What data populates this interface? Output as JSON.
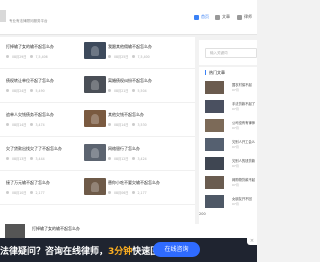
{
  "header": {
    "tagline": "专业有法律顾问服务平台",
    "nav": [
      {
        "label": "首页",
        "icon": "home-icon"
      },
      {
        "label": "文章",
        "icon": "article-icon"
      },
      {
        "label": "律师",
        "icon": "lawyer-icon"
      }
    ]
  },
  "articles": [
    {
      "title": "打掉输了女的输不起怎么办",
      "date": "08月29日",
      "views": "7,5,406"
    },
    {
      "title": "我跟其他佣输不起怎么办",
      "date": "08月25日",
      "views": "7,5,400"
    },
    {
      "title": "债权转让单位不起了怎么办",
      "date": "08月24日",
      "views": "5,490"
    },
    {
      "title": "离婚债权纠纷不起怎么办",
      "date": "08月21日",
      "views": "5,504"
    },
    {
      "title": "追单人欠钱债务不起怎么办",
      "date": "08月14日",
      "views": "3,474"
    },
    {
      "title": "其他欠钱不起怎么办",
      "date": "08月14日",
      "views": "3,530"
    },
    {
      "title": "欠了贷款出找欠了了不起怎么办",
      "date": "08月13日",
      "views": "3,444"
    },
    {
      "title": "网络银行了怎么办",
      "date": "08月12日",
      "views": "3,424"
    },
    {
      "title": "接了万元输不起了怎么办",
      "date": "08月10日",
      "views": "2,177"
    },
    {
      "title": "替你小吃不要欠输不起怎么办",
      "date": "08月06日",
      "views": "2,177"
    }
  ],
  "sidebar": {
    "search_placeholder": "输入关键词",
    "hot_title": "热门文章",
    "hot_items": [
      {
        "text": "国农村保不起",
        "date": "07月"
      },
      {
        "text": "手法贷款不起了",
        "date": "07月"
      },
      {
        "text": "公司没有有律师",
        "date": "07月"
      },
      {
        "text": "欠别人开工会么",
        "date": "07月"
      },
      {
        "text": "欠别人的钱贷款",
        "date": "07月"
      },
      {
        "text": "网购物贷款不起",
        "date": "07月"
      },
      {
        "text": "女朋友开不回",
        "date": "07月"
      }
    ]
  },
  "footer_strip": {
    "title": "打掉输了女的输不起怎么办",
    "side": "200"
  },
  "banner": {
    "text_before": "法律疑问？咨询在线律师，",
    "highlight": "3分钟",
    "text_after": "快速回复！",
    "button": "在线咨询",
    "close": "×"
  }
}
